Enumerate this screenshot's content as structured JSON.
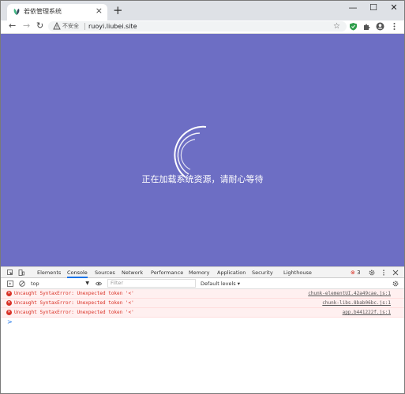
{
  "browser": {
    "tab_title": "若依管理系统",
    "new_tab_label": "+",
    "close_tab_label": "×",
    "window_controls": {
      "minimize": "—",
      "maximize": "☐",
      "close": "✕"
    },
    "nav": {
      "back": "←",
      "forward": "→",
      "reload": "↻"
    },
    "security_label": "不安全",
    "url": "ruoyi.liubei.site",
    "star": "☆"
  },
  "page": {
    "loading_text": "正在加载系统资源，请耐心等待",
    "background_color": "#6d6ec4"
  },
  "devtools": {
    "tabs": [
      "Elements",
      "Console",
      "Sources",
      "Network",
      "Performance",
      "Memory",
      "Application",
      "Security",
      "Lighthouse"
    ],
    "active_tab": "Console",
    "error_count": "3",
    "context": "top",
    "filter_placeholder": "Filter",
    "levels_label": "Default levels ▾",
    "messages": [
      {
        "text": "Uncaught SyntaxError: Unexpected token '<'",
        "source": "chunk-elementUI.42a49cae.js:1"
      },
      {
        "text": "Uncaught SyntaxError: Unexpected token '<'",
        "source": "chunk-libs.8bab06bc.js:1"
      },
      {
        "text": "Uncaught SyntaxError: Unexpected token '<'",
        "source": "app.b441222f.js:1"
      }
    ],
    "prompt_symbol": ">"
  }
}
